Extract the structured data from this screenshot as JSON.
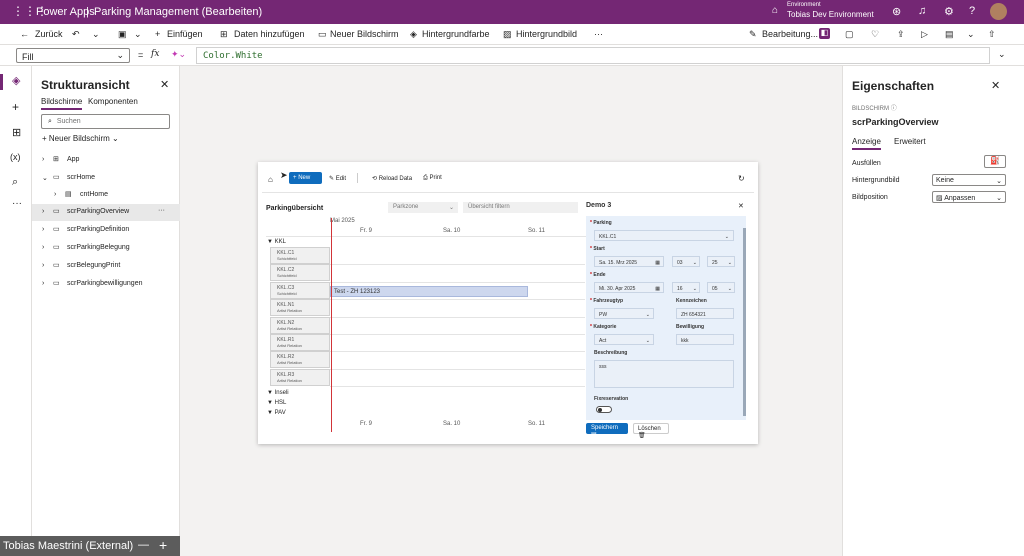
{
  "titlebar": {
    "app_name": "Power Apps",
    "separator": "|",
    "title": "Parking Management (Bearbeiten)",
    "env_label": "Environment",
    "env_name": "Tobias Dev Environment"
  },
  "cmdbar": {
    "back": "Zurück",
    "insert": "Einfügen",
    "add_data": "Daten hinzufügen",
    "new_screen": "Neuer Bildschirm",
    "bg_color": "Hintergrundfarbe",
    "bg_image": "Hintergrundbild",
    "more": "···",
    "editing": "Bearbeitung..."
  },
  "formula": {
    "property": "Fill",
    "eq": "=",
    "fx": "fx",
    "value": "Color.White"
  },
  "tree": {
    "title": "Strukturansicht",
    "tab_screens": "Bildschirme",
    "tab_components": "Komponenten",
    "search_placeholder": "Suchen",
    "new_screen": "Neuer Bildschirm",
    "items": [
      {
        "label": "App"
      },
      {
        "label": "scrHome"
      },
      {
        "label": "cntHome"
      },
      {
        "label": "scrParkingOverview"
      },
      {
        "label": "scrParkingDefinition"
      },
      {
        "label": "scrParkingBelegung"
      },
      {
        "label": "scrBelegungPrint"
      },
      {
        "label": "scrParkingbewilligungen"
      }
    ],
    "item_more": "···"
  },
  "footer": {
    "user": "Tobias Maestrini (External)",
    "minus": "—",
    "plus": "+"
  },
  "props": {
    "title": "Eigenschaften",
    "section_label": "BILDSCHIRM",
    "screen_name": "scrParkingOverview",
    "tab_display": "Anzeige",
    "tab_advanced": "Erweitert",
    "fill_label": "Ausfüllen",
    "bgimage_label": "Hintergrundbild",
    "bgimage_value": "Keine",
    "imgpos_label": "Bildposition",
    "imgpos_value": "Anpassen"
  },
  "app": {
    "new_btn": "New",
    "edit_btn": "Edit",
    "reload_btn": "Reload Data",
    "print_btn": "Print",
    "overview_title": "Parkingübersicht",
    "filter_zone": "Parkzone",
    "filter_overview": "Übersicht filtern",
    "month": "Mai 2025",
    "days": [
      "Fr. 9",
      "Sa. 10",
      "So. 11"
    ],
    "groups": [
      "KKL",
      "Inseli",
      "HSL",
      "PAV"
    ],
    "spots": [
      {
        "name": "KKL.C1",
        "sub": "Schichtfeld"
      },
      {
        "name": "KKL.C2",
        "sub": "Schichtfeld"
      },
      {
        "name": "KKL.C3",
        "sub": "Schichtfeld"
      },
      {
        "name": "KKL.N1",
        "sub": "Artist Relation"
      },
      {
        "name": "KKL.N2",
        "sub": "Artist Relation"
      },
      {
        "name": "KKL.R1",
        "sub": "Artist Relation"
      },
      {
        "name": "KKL.R2",
        "sub": "Artist Relation"
      },
      {
        "name": "KKL.R3",
        "sub": "Artist Relation"
      }
    ],
    "booking": "Test - ZH 123123",
    "form": {
      "title": "Demo 3",
      "parking_label": "Parking",
      "parking_value": "KKL.C1",
      "start_label": "Start",
      "start_date": "Sa. 15. Mrz 2025",
      "start_h": "03",
      "start_m": "25",
      "end_label": "Ende",
      "end_date": "Mi. 30. Apr 2025",
      "end_h": "16",
      "end_m": "05",
      "vtype_label": "Fahrzeugtyp",
      "vtype_value": "PW",
      "plate_label": "Kennzeichen",
      "plate_value": "ZH 654321",
      "cat_label": "Kategorie",
      "cat_value": "Act",
      "perm_label": "Bewilligung",
      "perm_value": "kkk",
      "desc_label": "Beschreibung",
      "desc_value": "sss",
      "fix_label": "Fixreservation",
      "save": "Speichern",
      "delete": "Löschen"
    }
  },
  "colors": {
    "brand": "#742774",
    "accent": "#0f6cbd",
    "today_line": "#d13438"
  }
}
